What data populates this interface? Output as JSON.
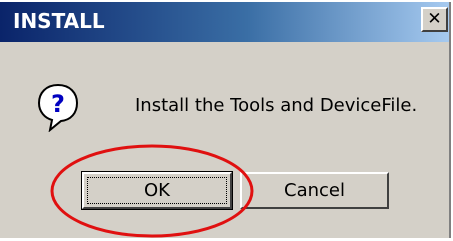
{
  "window": {
    "title": "INSTALL",
    "close_glyph": "✕"
  },
  "dialog": {
    "icon": "question-icon",
    "message": "Install the Tools and DeviceFile."
  },
  "buttons": {
    "ok_label": "OK",
    "cancel_label": "Cancel"
  },
  "colors": {
    "titlebar_start": "#0a246a",
    "titlebar_end": "#a6caf0",
    "dialog_face": "#d4d0c8",
    "annotation_circle": "#e01010"
  }
}
